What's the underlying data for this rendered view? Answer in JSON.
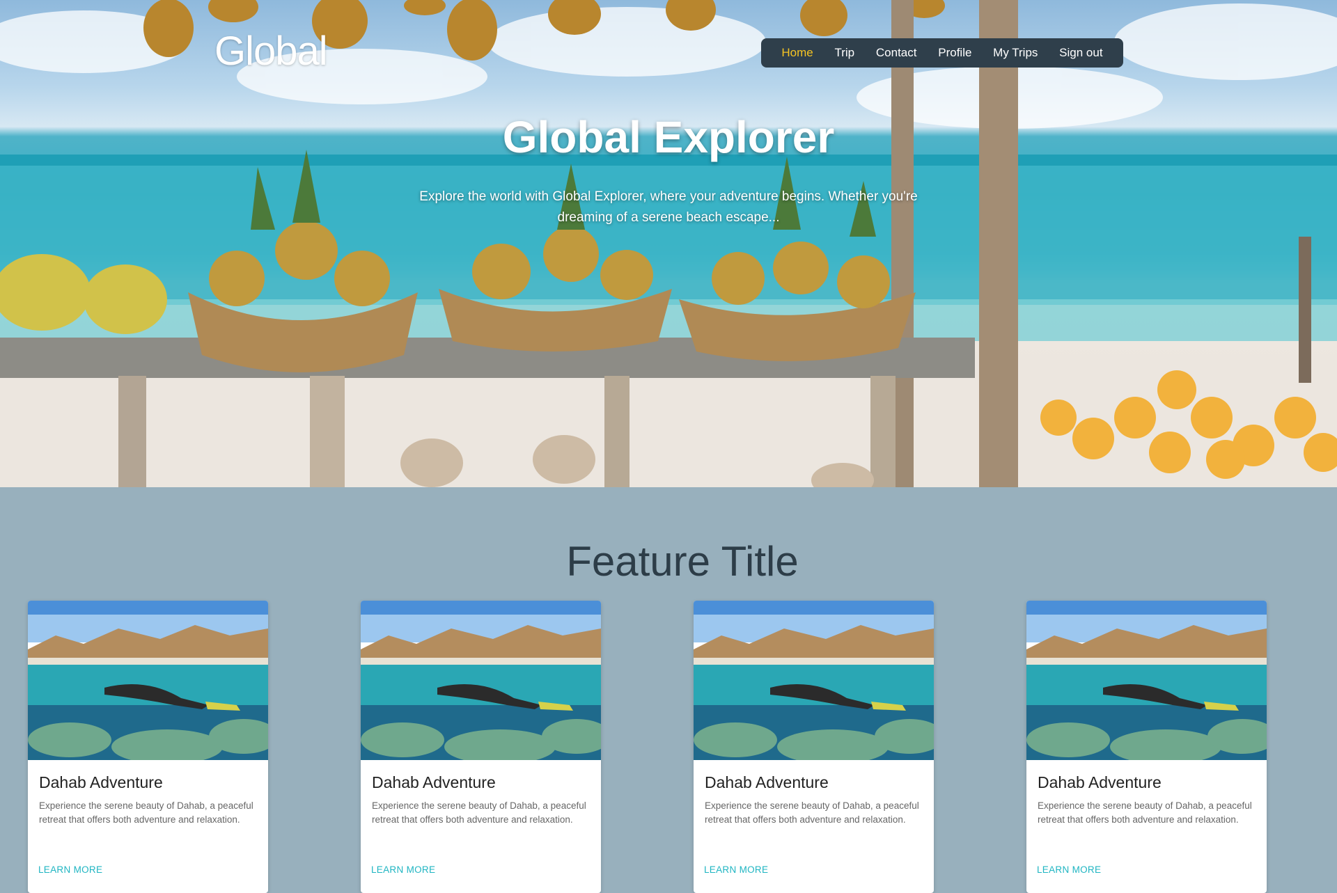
{
  "header": {
    "brand": "Global",
    "nav": [
      {
        "label": "Home",
        "active": true
      },
      {
        "label": "Trip"
      },
      {
        "label": "Contact"
      },
      {
        "label": "Profile"
      },
      {
        "label": "My Trips"
      },
      {
        "label": "Sign out"
      }
    ]
  },
  "hero": {
    "title": "Global Explorer",
    "subtitle": "Explore the world with Global Explorer, where your adventure begins. Whether you're dreaming of a serene beach escape..."
  },
  "features": {
    "title": "Feature Title",
    "cards": [
      {
        "title": "Dahab Adventure",
        "text": "Experience the serene beauty of Dahab, a peaceful retreat that offers both adventure and relaxation.",
        "link": "LEARN MORE"
      },
      {
        "title": "Dahab Adventure",
        "text": "Experience the serene beauty of Dahab, a peaceful retreat that offers both adventure and relaxation.",
        "link": "LEARN MORE"
      },
      {
        "title": "Dahab Adventure",
        "text": "Experience the serene beauty of Dahab, a peaceful retreat that offers both adventure and relaxation.",
        "link": "LEARN MORE"
      },
      {
        "title": "Dahab Adventure",
        "text": "Experience the serene beauty of Dahab, a peaceful retreat that offers both adventure and relaxation.",
        "link": "LEARN MORE"
      }
    ]
  },
  "colors": {
    "nav_bg": "#2f3f4b",
    "nav_active": "#f5c423",
    "section_bg": "#98b0bd",
    "link": "#1fb5c2"
  }
}
